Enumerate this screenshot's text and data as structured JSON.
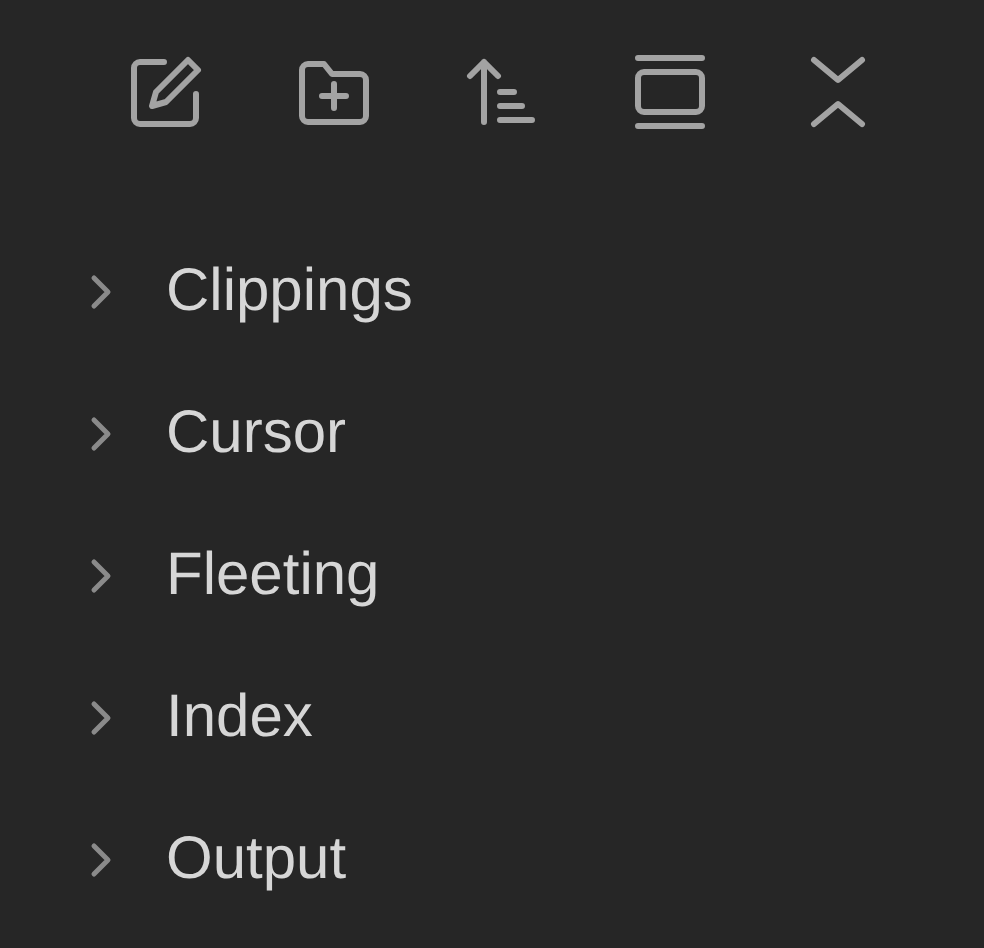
{
  "folders": [
    {
      "name": "Clippings",
      "expanded": false
    },
    {
      "name": "Cursor",
      "expanded": false
    },
    {
      "name": "Fleeting",
      "expanded": false
    },
    {
      "name": "Index",
      "expanded": false
    },
    {
      "name": "Output",
      "expanded": false
    }
  ]
}
